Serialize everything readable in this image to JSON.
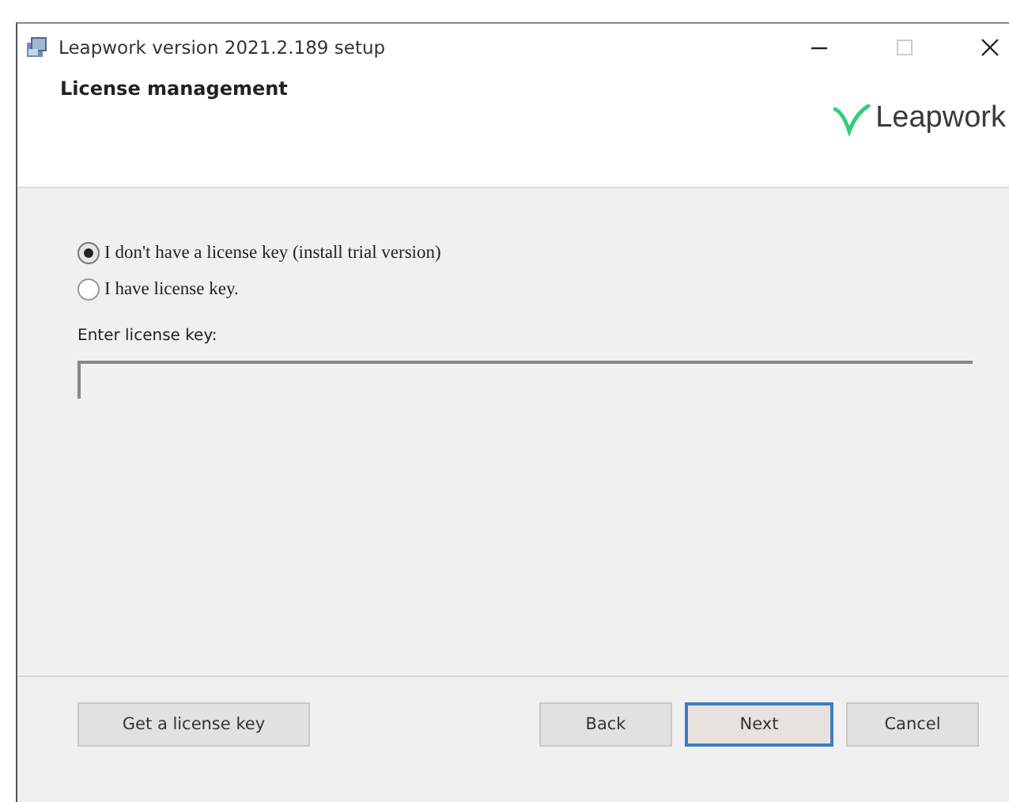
{
  "window": {
    "title": "Leapwork version 2021.2.189 setup"
  },
  "header": {
    "title": "License management",
    "logo": "Leapwork"
  },
  "options": [
    {
      "label": "I don't have a license key (install trial version)",
      "selected": true
    },
    {
      "label": "I have license key.",
      "selected": false
    }
  ],
  "license_field": {
    "label": "Enter license key:"
  },
  "left_buttons": [
    {
      "label": "Get a license key",
      "focused": false
    }
  ],
  "right_buttons": [
    {
      "label": "Back",
      "focused": false
    },
    {
      "label": "Next",
      "focused": true
    },
    {
      "label": "Cancel",
      "focused": false
    }
  ]
}
